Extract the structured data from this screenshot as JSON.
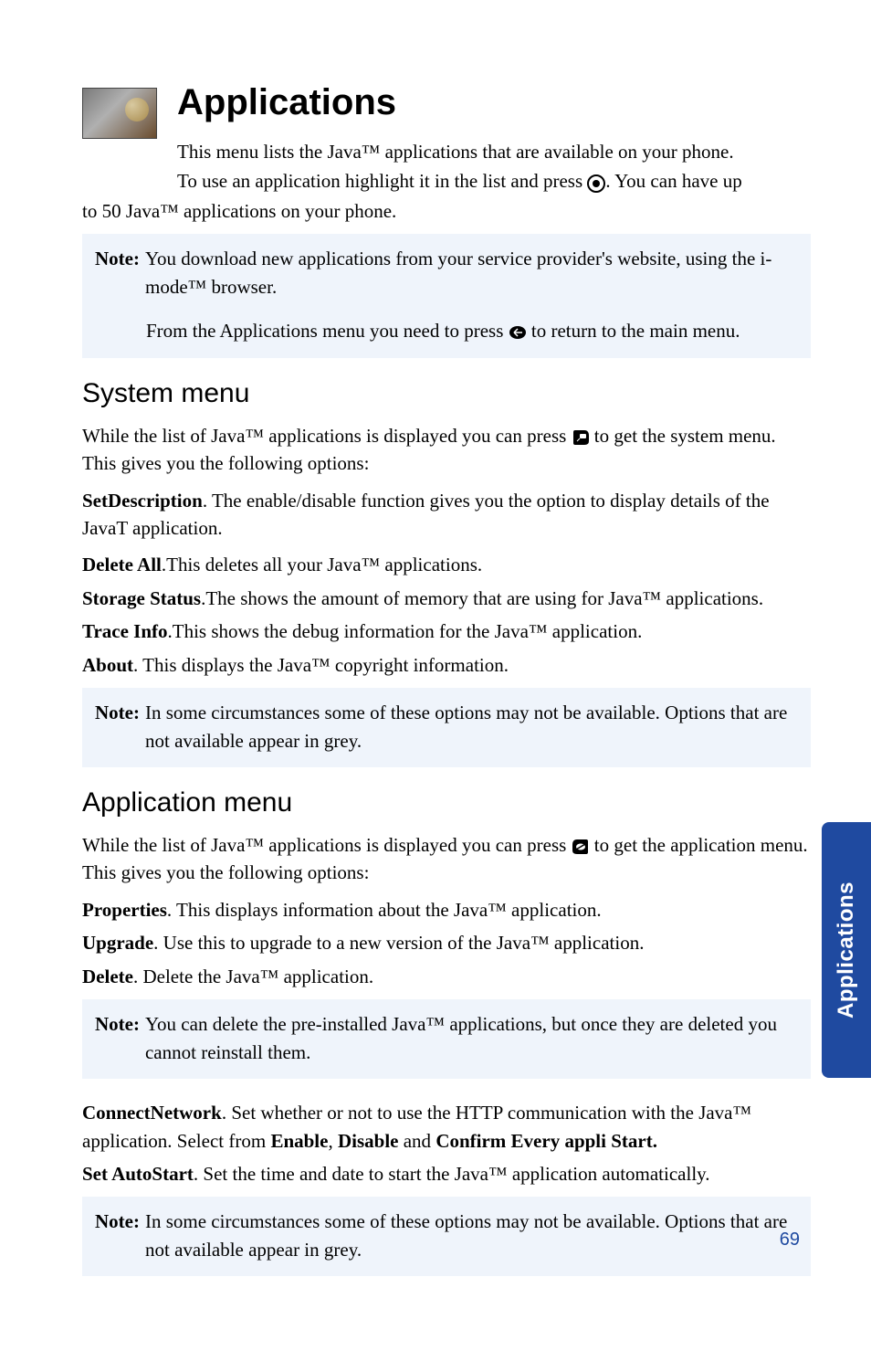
{
  "sideTab": "Applications",
  "pageNumber": "69",
  "title": "Applications",
  "intro": {
    "line1": "This menu lists the Java™ applications that are available on your phone.",
    "line2a": "To use an application highlight it in the list and press ",
    "line2b": ". You can have up",
    "wrap": "to 50 Java™ applications on your phone."
  },
  "note1": {
    "label": "Note:",
    "text": "You download new applications from your service provider's website, using the i-mode™ browser.",
    "extraA": "From the Applications menu you need to press ",
    "extraB": " to return to the main menu."
  },
  "systemMenu": {
    "heading": "System menu",
    "introA": "While the list of Java™ applications is displayed you can press ",
    "introB": " to get the system menu. This gives you the following options:",
    "setDescLabel": "SetDescription",
    "setDescText": ". The enable/disable function gives you the option to display details of the JavaT application.",
    "deleteAllLabel": "Delete All",
    "deleteAllText": ".This deletes all your Java™ applications.",
    "storageLabel": "Storage Status",
    "storageText": ".The shows the amount of memory that are using for Java™ applications.",
    "traceLabel": "Trace Info",
    "traceText": ".This shows the debug information for the Java™ application.",
    "aboutLabel": "About",
    "aboutText": ". This displays the Java™ copyright information."
  },
  "note2": {
    "label": "Note:",
    "text": "In some circumstances some of these options may not be available. Options that are not available appear in grey."
  },
  "appMenu": {
    "heading": "Application menu",
    "introA": "While the list of Java™ applications is displayed you can press ",
    "introB": " to get the application menu. This gives you the following options:",
    "propsLabel": "Properties",
    "propsText": ". This displays information about the Java™ application.",
    "upgradeLabel": "Upgrade",
    "upgradeText": ". Use this to upgrade to a new version of the Java™ application.",
    "deleteLabel": "Delete",
    "deleteText": ". Delete the Java™ application."
  },
  "note3": {
    "label": "Note:",
    "text": "You can delete the pre-installed Java™ applications, but once they are deleted you cannot reinstall them."
  },
  "connect": {
    "label": "ConnectNetwork",
    "textA": ". Set whether or not to use the HTTP communication with the Java™ application. Select from ",
    "enable": "Enable",
    "sep1": ", ",
    "disable": "Disable",
    "sep2": " and ",
    "confirm": "Confirm Every appli Start."
  },
  "autoStart": {
    "label": "Set AutoStart",
    "text": ". Set the time and date to start the Java™ application automatically."
  },
  "note4": {
    "label": "Note:",
    "text": "In some circumstances some of these options may not be available. Options that are not available appear in grey."
  },
  "icons": {
    "center": "center-key-icon",
    "back": "back-key-icon",
    "right": "right-softkey-icon",
    "left": "left-softkey-icon"
  }
}
